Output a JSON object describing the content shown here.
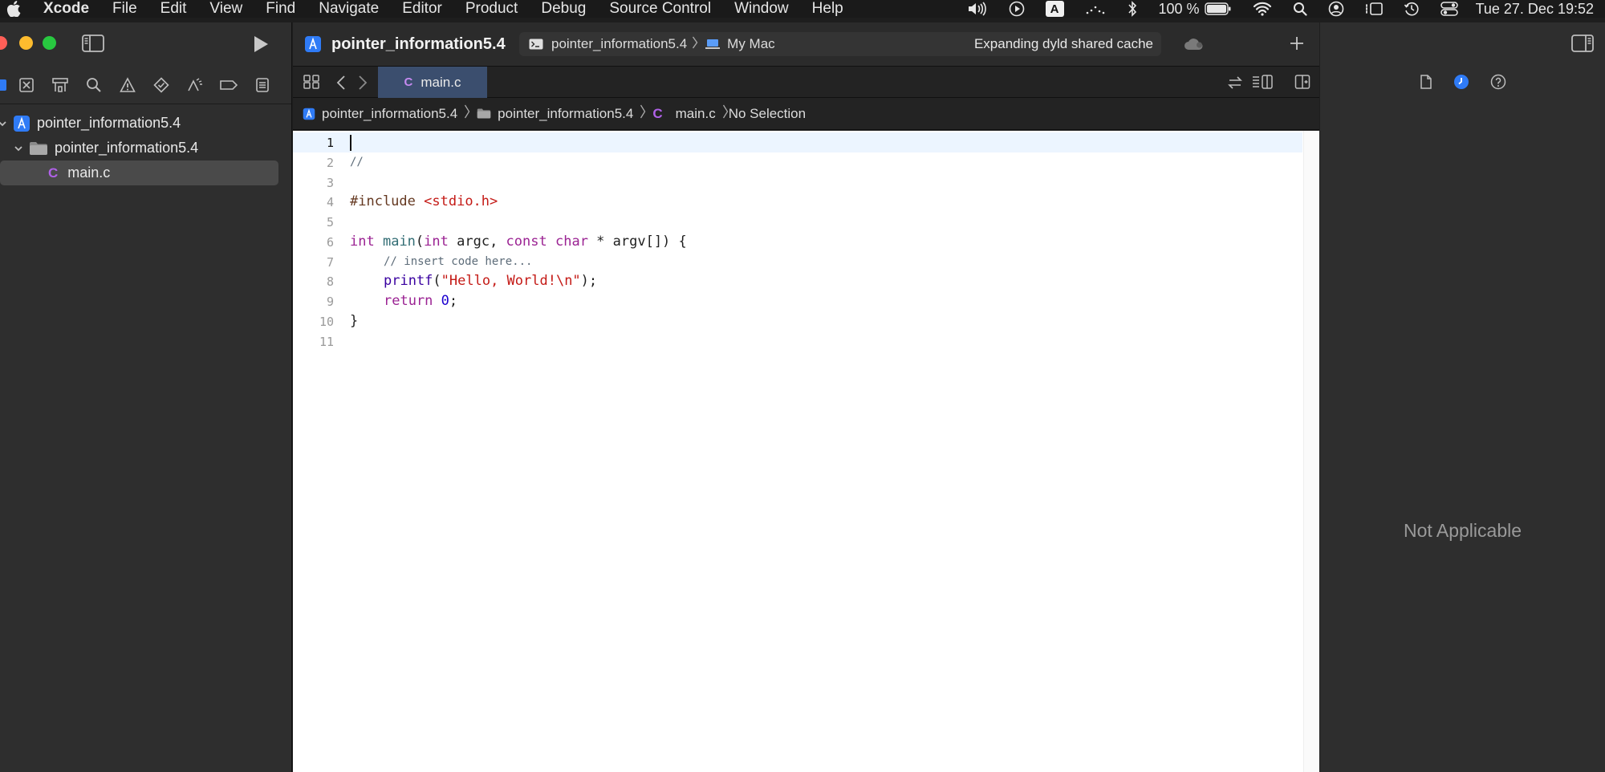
{
  "menubar": {
    "app_name": "Xcode",
    "items": [
      "File",
      "Edit",
      "View",
      "Find",
      "Navigate",
      "Editor",
      "Product",
      "Debug",
      "Source Control",
      "Window",
      "Help"
    ],
    "input_source": "A",
    "battery": "100 %",
    "clock": "Tue 27. Dec  19:52"
  },
  "navigator": {
    "tree": [
      {
        "label": "pointer_information5.4",
        "type": "project"
      },
      {
        "label": "pointer_information5.4",
        "type": "folder"
      },
      {
        "label": "main.c",
        "type": "c-file"
      }
    ]
  },
  "toolbar": {
    "project_title": "pointer_information5.4",
    "scheme_name": "pointer_information5.4",
    "destination": "My Mac",
    "activity_status": "Expanding dyld shared cache"
  },
  "tab": {
    "label": "main.c",
    "icon_letter": "C"
  },
  "jumpbar": {
    "project": "pointer_information5.4",
    "folder": "pointer_information5.4",
    "file": "main.c",
    "selection": "No Selection"
  },
  "code": {
    "line_numbers": [
      "1",
      "2",
      "3",
      "4",
      "5",
      "6",
      "7",
      "8",
      "9",
      "10",
      "11"
    ],
    "current_line": 1,
    "lines": {
      "l2": "//",
      "l4_directive": "#include",
      "l4_header": "<stdio.h>",
      "l6_int1": "int",
      "l6_main": "main",
      "l6_paren": "(",
      "l6_int2": "int",
      "l6_argc": " argc, ",
      "l6_const": "const",
      "l6_char": "char",
      "l6_rest": " * argv[]) {",
      "l7": "// insert code here...",
      "l8_printf": "printf",
      "l8_open": "(",
      "l8_str": "\"Hello, World!\\n\"",
      "l8_close": ");",
      "l9_return": "return",
      "l9_num": "0",
      "l9_semi": ";",
      "l10": "}"
    }
  },
  "inspector": {
    "placeholder": "Not Applicable"
  },
  "colors": {
    "close": "#ff5f57",
    "minimize": "#febc2e",
    "zoom": "#28c840",
    "accent": "#2f7bf6"
  }
}
